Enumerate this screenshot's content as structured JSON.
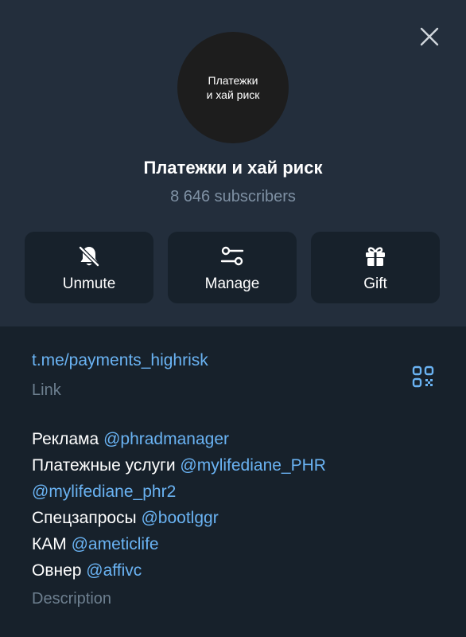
{
  "header": {
    "avatar_text": "Платежки\nи хай риск",
    "title": "Платежки и хай риск",
    "subscribers": "8 646 subscribers"
  },
  "actions": [
    {
      "label": "Unmute",
      "icon": "bell-off-icon"
    },
    {
      "label": "Manage",
      "icon": "sliders-icon"
    },
    {
      "label": "Gift",
      "icon": "gift-icon"
    }
  ],
  "info": {
    "link": "t.me/payments_highrisk",
    "link_caption": "Link",
    "description_lines": [
      {
        "text": "Реклама ",
        "mention": "@phradmanager"
      },
      {
        "text": "Платежные услуги ",
        "mention": "@mylifediane_PHR"
      },
      {
        "text": "",
        "mention": "@mylifediane_phr2"
      },
      {
        "text": "Спецзапросы ",
        "mention": "@bootlggr"
      },
      {
        "text": "КАМ ",
        "mention": "@ameticlife"
      },
      {
        "text": "Овнер ",
        "mention": "@affivc"
      }
    ],
    "description_caption": "Description"
  },
  "colors": {
    "header_bg": "#232e3c",
    "body_bg": "#17212b",
    "accent": "#6ab3f3",
    "muted": "#7f91a4"
  }
}
